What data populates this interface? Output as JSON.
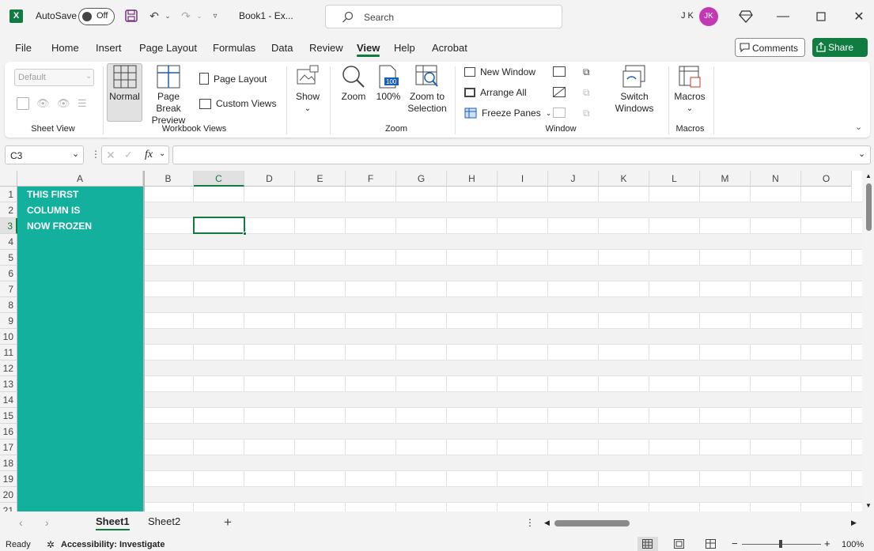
{
  "titlebar": {
    "app_logo": "X",
    "autosave_label": "AutoSave",
    "autosave_state": "Off",
    "document_title": "Book1 - Ex...",
    "search_placeholder": "Search",
    "user_initials": "J K",
    "avatar_initials": "JK"
  },
  "menu": [
    "File",
    "Home",
    "Insert",
    "Page Layout",
    "Formulas",
    "Data",
    "Review",
    "View",
    "Help",
    "Acrobat"
  ],
  "menu_active": "View",
  "comments_label": "Comments",
  "share_label": "Share",
  "ribbon": {
    "sheet_view": {
      "style_value": "Default",
      "label": "Sheet View"
    },
    "workbook_views": {
      "normal": "Normal",
      "page_break_1": "Page Break",
      "page_break_2": "Preview",
      "page_layout": "Page Layout",
      "custom_views": "Custom Views",
      "label": "Workbook Views"
    },
    "show": "Show",
    "zoom": {
      "zoom": "Zoom",
      "hundred": "100%",
      "to_sel_1": "Zoom to",
      "to_sel_2": "Selection",
      "label": "Zoom"
    },
    "window": {
      "new_window": "New Window",
      "arrange_all": "Arrange All",
      "freeze_panes": "Freeze Panes",
      "switch_1": "Switch",
      "switch_2": "Windows",
      "label": "Window"
    },
    "macros": {
      "button": "Macros",
      "label": "Macros"
    }
  },
  "formula_bar": {
    "name_box": "C3",
    "fx": "fx",
    "formula": ""
  },
  "columns": [
    "A",
    "B",
    "C",
    "D",
    "E",
    "F",
    "G",
    "H",
    "I",
    "J",
    "K",
    "L",
    "M",
    "N",
    "O"
  ],
  "rows": [
    "1",
    "2",
    "3",
    "4",
    "5",
    "6",
    "7",
    "8",
    "9",
    "10",
    "11",
    "12",
    "13",
    "14",
    "15",
    "16",
    "17",
    "18",
    "19",
    "20",
    "21"
  ],
  "selected_cell": "C3",
  "frozen_text": [
    "THIS FIRST",
    "COLUMN IS",
    "NOW FROZEN"
  ],
  "frozen_color": "#12b09d",
  "accent_color": "#107c41",
  "sheets": [
    "Sheet1",
    "Sheet2"
  ],
  "active_sheet": "Sheet1",
  "status": {
    "ready": "Ready",
    "accessibility": "Accessibility: Investigate",
    "zoom": "100%"
  }
}
